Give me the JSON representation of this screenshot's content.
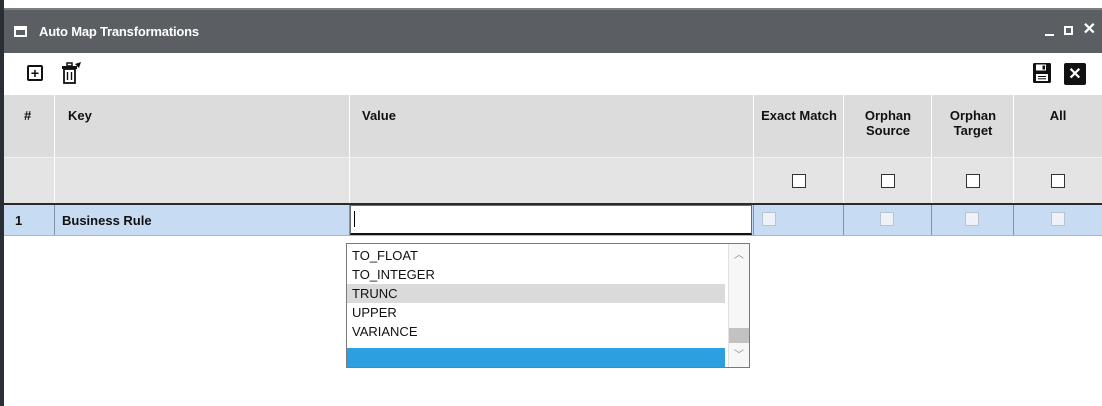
{
  "window": {
    "title": "Auto Map Transformations",
    "controls": {
      "minimize": "_",
      "maximize": "□",
      "close": "✕"
    }
  },
  "toolbar": {
    "add_icon": "add-icon",
    "delete_icon": "delete-icon",
    "save_icon": "save-icon",
    "close_icon": "close-icon"
  },
  "table": {
    "headers": {
      "index": "#",
      "key": "Key",
      "value": "Value",
      "exact_match": "Exact Match",
      "orphan_source": "Orphan Source",
      "orphan_target": "Orphan Target",
      "all": "All"
    },
    "rows": [
      {
        "index": "1",
        "key": "Business Rule",
        "value": ""
      }
    ]
  },
  "dropdown": {
    "items": [
      "TO_FLOAT",
      "TO_INTEGER",
      "TRUNC",
      "UPPER",
      "VARIANCE",
      ""
    ],
    "highlighted": "TRUNC"
  },
  "colors": {
    "title_bar": "#5b5e63",
    "header_bg": "#dcdcdc",
    "row_selected": "#c7dcf2",
    "dropdown_selected": "#2b9fdf"
  }
}
